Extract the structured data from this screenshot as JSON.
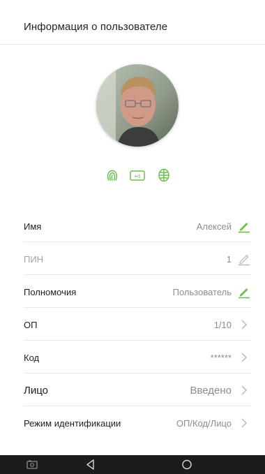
{
  "header": {
    "title": "Информация о пользователе"
  },
  "profile": {
    "photo_alt": "Фото пользователя"
  },
  "verification_methods": [
    {
      "icon": "fingerprint-icon"
    },
    {
      "icon": "card-icon"
    },
    {
      "icon": "face-icon"
    }
  ],
  "colors": {
    "accent": "#6cc04a",
    "muted": "#a3a3a3",
    "text": "#1e1e1e",
    "value": "#8c8c8c"
  },
  "fields": {
    "name": {
      "label": "Имя",
      "value": "Алексей"
    },
    "pin": {
      "label": "ПИН",
      "value": "1"
    },
    "role": {
      "label": "Полномочия",
      "value": "Пользователь"
    },
    "fp": {
      "label": "ОП",
      "value": "1/10"
    },
    "code": {
      "label": "Код",
      "value": "******"
    },
    "face": {
      "label": "Лицо",
      "value": "Введено"
    },
    "mode": {
      "label": "Режим идентификации",
      "value": "ОП/Код/Лицо"
    }
  }
}
